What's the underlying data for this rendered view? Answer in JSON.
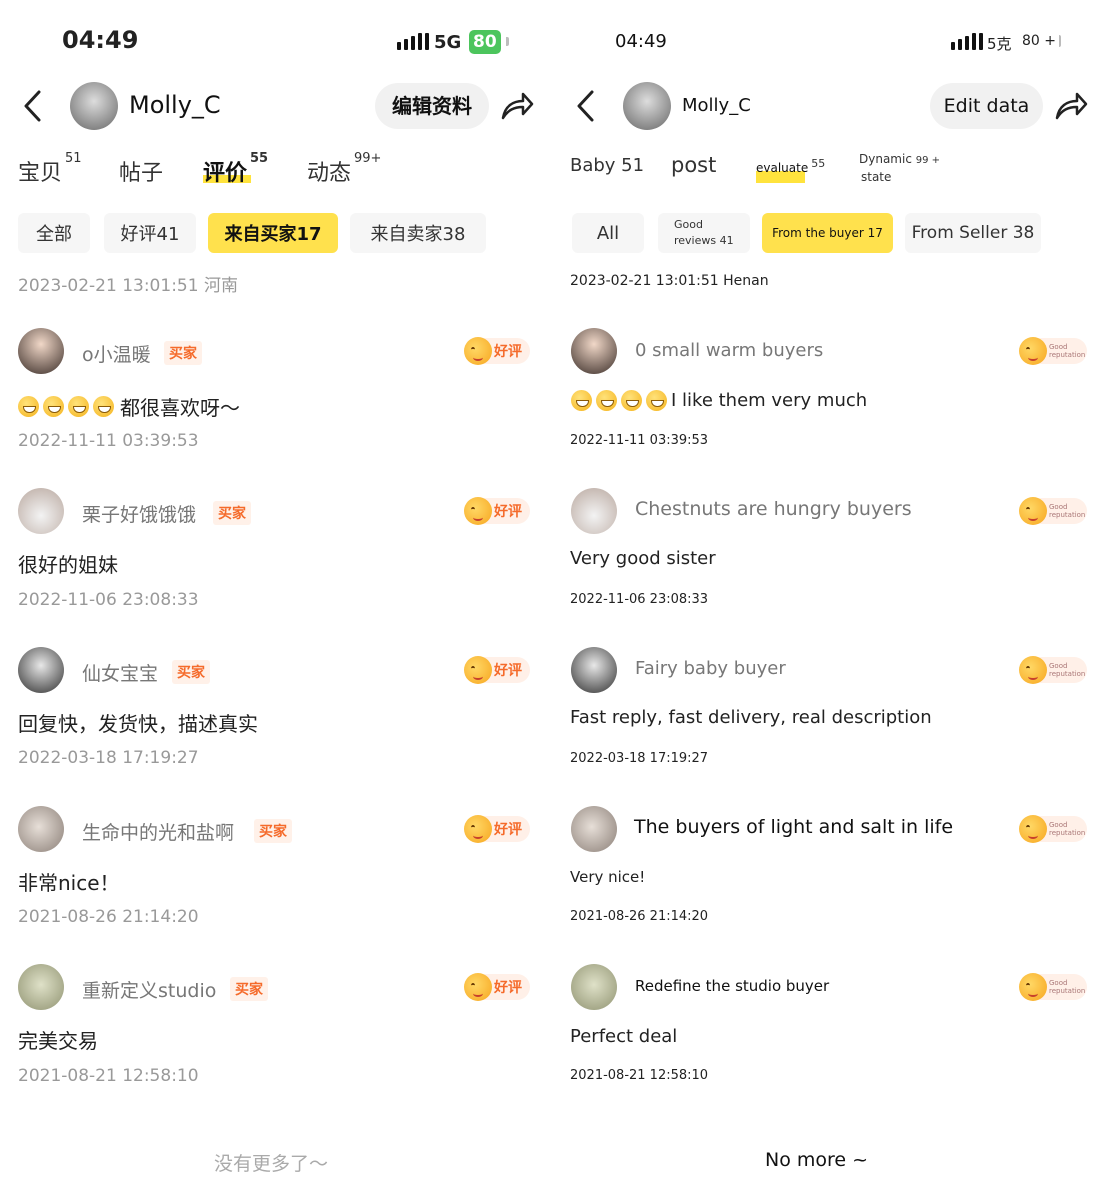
{
  "left": {
    "status": {
      "time": "04:49",
      "network": "5G",
      "battery": "80"
    },
    "header": {
      "username": "Molly_C",
      "edit_button": "编辑资料"
    },
    "tabs": [
      {
        "label": "宝贝",
        "count": "51"
      },
      {
        "label": "帖子",
        "count": ""
      },
      {
        "label": "评价",
        "count": "55"
      },
      {
        "label": "动态",
        "count": "99+"
      }
    ],
    "filters": [
      "全部",
      "好评41",
      "来自买家17",
      "来自卖家38"
    ],
    "timestamp_top": "2023-02-21 13:01:51 河南",
    "badge_label": "买家",
    "rating_label": "好评",
    "reviews": [
      {
        "user": "o小温暖",
        "text": "都很喜欢呀～",
        "date": "2022-11-11 03:39:53"
      },
      {
        "user": "栗子好饿饿饿",
        "text": "很好的姐妹",
        "date": "2022-11-06 23:08:33"
      },
      {
        "user": "仙女宝宝",
        "text": "回复快，发货快，描述真实",
        "date": "2022-03-18 17:19:27"
      },
      {
        "user": "生命中的光和盐啊",
        "text": "非常nice！",
        "date": "2021-08-26 21:14:20"
      },
      {
        "user": "重新定义studio",
        "text": "完美交易",
        "date": "2021-08-21 12:58:10"
      }
    ],
    "footer": "没有更多了～"
  },
  "right": {
    "status": {
      "time": "04:49",
      "network": "5克",
      "battery": "80 +"
    },
    "header": {
      "username": "Molly_C",
      "edit_button": "Edit data"
    },
    "tabs": [
      {
        "label": "Baby 51",
        "count": ""
      },
      {
        "label": "post",
        "count": ""
      },
      {
        "label": "evaluate",
        "count": "55"
      },
      {
        "label": "Dynamic",
        "count": "99 +",
        "sub": "state"
      }
    ],
    "filters": [
      "All",
      "Good\nreviews 41",
      "From the buyer 17",
      "From Seller 38"
    ],
    "timestamp_top": "2023-02-21 13:01:51 Henan",
    "rating_label": "Good reputation",
    "reviews": [
      {
        "user": "0 small warm buyers",
        "text": "I like them very much",
        "date": "2022-11-11 03:39:53"
      },
      {
        "user": "Chestnuts are hungry buyers",
        "text": "Very good sister",
        "date": "2022-11-06 23:08:33"
      },
      {
        "user": "Fairy baby buyer",
        "text": "Fast reply, fast delivery, real description",
        "date": "2022-03-18 17:19:27"
      },
      {
        "user": "The buyers of light and salt in life",
        "text": "Very nice!",
        "date": "2021-08-26 21:14:20"
      },
      {
        "user": "Redefine the studio buyer",
        "text": "Perfect deal",
        "date": "2021-08-21 12:58:10"
      }
    ],
    "footer": "No more ~"
  }
}
